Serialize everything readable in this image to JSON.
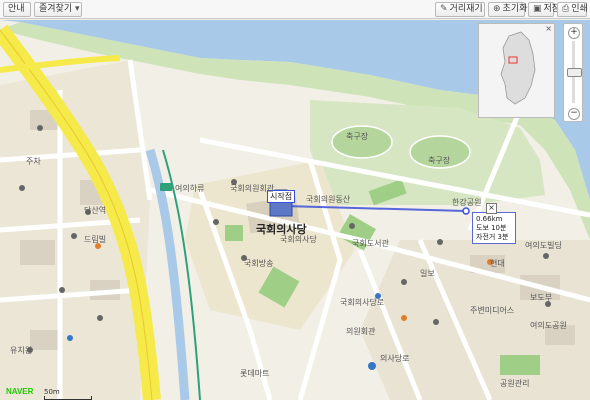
{
  "toolbar": {
    "guide": "안내",
    "favorites": "즐겨찾기",
    "measure": "거리재기",
    "reset": "초기화",
    "save": "저장",
    "print": "인쇄"
  },
  "map_labels": {
    "assembly": "국회의사당",
    "capitol_yard": "국회의사당",
    "starting_point": "시작점",
    "yeouido_station": "여의하류",
    "soccer": "축구장",
    "soccer2": "축구장",
    "yeouido_eastern": "국회의원동산",
    "hangang": "한강공원",
    "library": "국회도서관",
    "members_hall": "국회의원회관",
    "assembly_st": "의사당로",
    "hall2": "국회의사당로",
    "broadcast": "국회방송",
    "dangsan": "당산역",
    "mapo": "드림빌",
    "parking": "주차",
    "ilbo": "일보",
    "mbc": "주변미디어스",
    "kbs": "보도부",
    "sbs": "여의도빌딩",
    "apt": "여의도공원",
    "park": "공원관리",
    "kindergarten": "유치원",
    "hyundai": "현대",
    "lotte": "롯데마트",
    "kaist": "의원회관"
  },
  "measure": {
    "distance": "0.66km",
    "walk": "도보 10분",
    "bike": "자전거 3분"
  },
  "logo": "NAVER",
  "scale": "50m",
  "icons": {
    "close": "×"
  }
}
